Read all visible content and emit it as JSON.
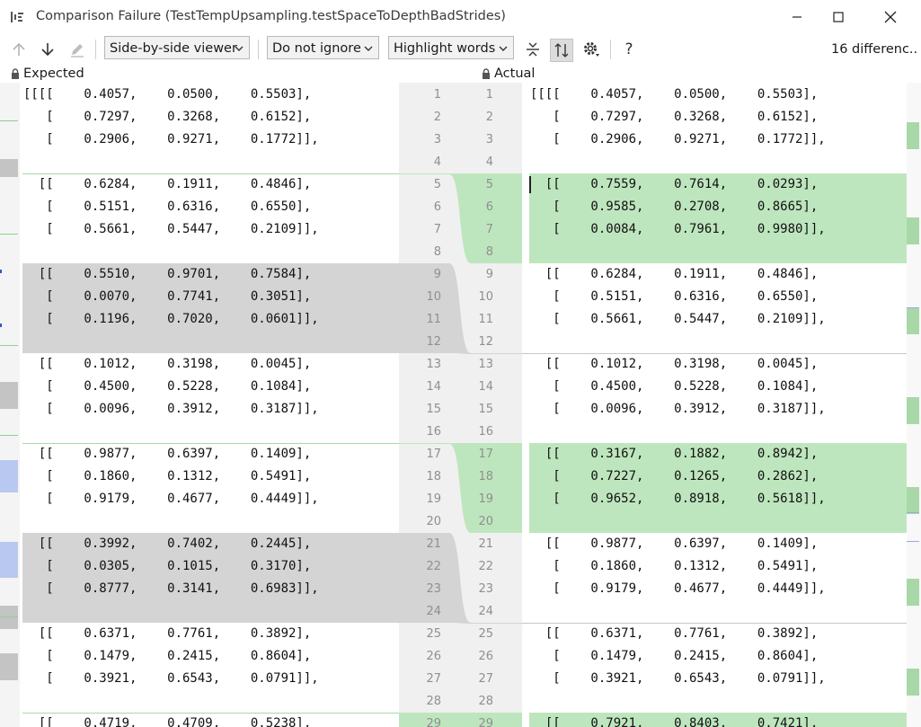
{
  "window": {
    "title": "Comparison Failure (TestTempUpsampling.testSpaceToDepthBadStrides)"
  },
  "toolbar": {
    "viewer_select": "Side-by-side viewer",
    "ignore_select": "Do not ignore",
    "highlight_select": "Highlight words",
    "help_label": "?",
    "diff_count": "16 differenc..."
  },
  "panels": {
    "left_label": "Expected",
    "right_label": "Actual"
  },
  "icons": {
    "app": "diff-icon",
    "prev": "arrow-up-icon",
    "next": "arrow-down-icon",
    "edit": "pencil-icon",
    "collapse": "collapse-unchanged-icon",
    "sync": "sync-scroll-icon",
    "settings": "gear-icon",
    "lock": "lock-icon"
  },
  "colors": {
    "changed_green": "#bee6be",
    "removed_grey": "#d4d4d4",
    "gutter": "#f0f0f0"
  },
  "left_numbers": [
    "1",
    "2",
    "3",
    "4",
    "5",
    "6",
    "7",
    "8",
    "9",
    "10",
    "11",
    "12",
    "13",
    "14",
    "15",
    "16",
    "17",
    "18",
    "19",
    "20",
    "21",
    "22",
    "23",
    "24",
    "25",
    "26",
    "27",
    "28",
    "29"
  ],
  "right_numbers": [
    "1",
    "2",
    "3",
    "4",
    "5",
    "6",
    "7",
    "8",
    "9",
    "10",
    "11",
    "12",
    "13",
    "14",
    "15",
    "16",
    "17",
    "18",
    "19",
    "20",
    "21",
    "22",
    "23",
    "24",
    "25",
    "26",
    "27",
    "28",
    "29"
  ],
  "left_lines": [
    "[[[[    0.4057,    0.0500,    0.5503],",
    "   [    0.7297,    0.3268,    0.6152],",
    "   [    0.2906,    0.9271,    0.1772]],",
    "",
    "  [[    0.6284,    0.1911,    0.4846],",
    "   [    0.5151,    0.6316,    0.6550],",
    "   [    0.5661,    0.5447,    0.2109]],",
    "",
    "  [[    0.5510,    0.9701,    0.7584],",
    "   [    0.0070,    0.7741,    0.3051],",
    "   [    0.1196,    0.7020,    0.0601]],",
    "",
    "  [[    0.1012,    0.3198,    0.0045],",
    "   [    0.4500,    0.5228,    0.1084],",
    "   [    0.0096,    0.3912,    0.3187]],",
    "",
    "  [[    0.9877,    0.6397,    0.1409],",
    "   [    0.1860,    0.1312,    0.5491],",
    "   [    0.9179,    0.4677,    0.4449]],",
    "",
    "  [[    0.3992,    0.7402,    0.2445],",
    "   [    0.0305,    0.1015,    0.3170],",
    "   [    0.8777,    0.3141,    0.6983]],",
    "",
    "  [[    0.6371,    0.7761,    0.3892],",
    "   [    0.1479,    0.2415,    0.8604],",
    "   [    0.3921,    0.6543,    0.0791]],",
    "",
    "  [[    0.4719,    0.4709,    0.5238],"
  ],
  "right_lines": [
    "[[[[    0.4057,    0.0500,    0.5503],",
    "   [    0.7297,    0.3268,    0.6152],",
    "   [    0.2906,    0.9271,    0.1772]],",
    "",
    "  [[    0.7559,    0.7614,    0.0293],",
    "   [    0.9585,    0.2708,    0.8665],",
    "   [    0.0084,    0.7961,    0.9980]],",
    "",
    "  [[    0.6284,    0.1911,    0.4846],",
    "   [    0.5151,    0.6316,    0.6550],",
    "   [    0.5661,    0.5447,    0.2109]],",
    "",
    "  [[    0.1012,    0.3198,    0.0045],",
    "   [    0.4500,    0.5228,    0.1084],",
    "   [    0.0096,    0.3912,    0.3187]],",
    "",
    "  [[    0.3167,    0.1882,    0.8942],",
    "   [    0.7227,    0.1265,    0.2862],",
    "   [    0.9652,    0.8918,    0.5618]],",
    "",
    "  [[    0.9877,    0.6397,    0.1409],",
    "   [    0.1860,    0.1312,    0.5491],",
    "   [    0.9179,    0.4677,    0.4449]],",
    "",
    "  [[    0.6371,    0.7761,    0.3892],",
    "   [    0.1479,    0.2415,    0.8604],",
    "   [    0.3921,    0.6543,    0.0791]],",
    "",
    "  [[    0.7921,    0.8403,    0.7421],"
  ]
}
